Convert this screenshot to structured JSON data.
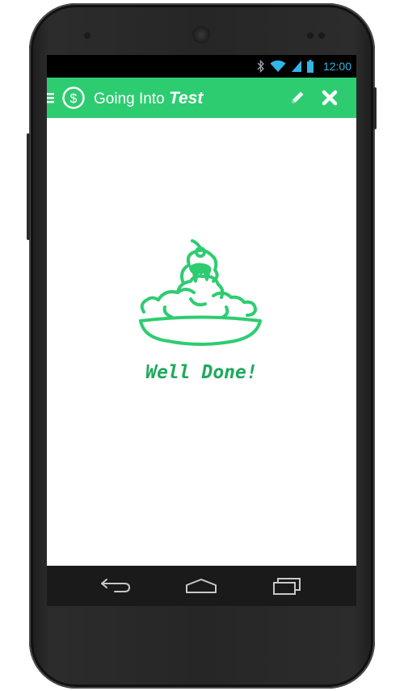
{
  "status_bar": {
    "time": "12:00",
    "icons": [
      "bluetooth-icon",
      "wifi-icon",
      "cell-signal-icon",
      "battery-icon"
    ],
    "accent_color": "#33b5e5"
  },
  "action_bar": {
    "title_part1": "Going Into ",
    "title_part2": "Test",
    "background_color": "#2ecc71",
    "icons": [
      "menu-icon",
      "dollar-circle-icon",
      "pencil-icon",
      "close-icon"
    ]
  },
  "content": {
    "message": "Well Done!",
    "illustration": "ice-cream-sundae-icon",
    "accent_color": "#2ecc71"
  },
  "nav_bar": {
    "buttons": [
      "back-icon",
      "home-icon",
      "recents-icon"
    ]
  }
}
